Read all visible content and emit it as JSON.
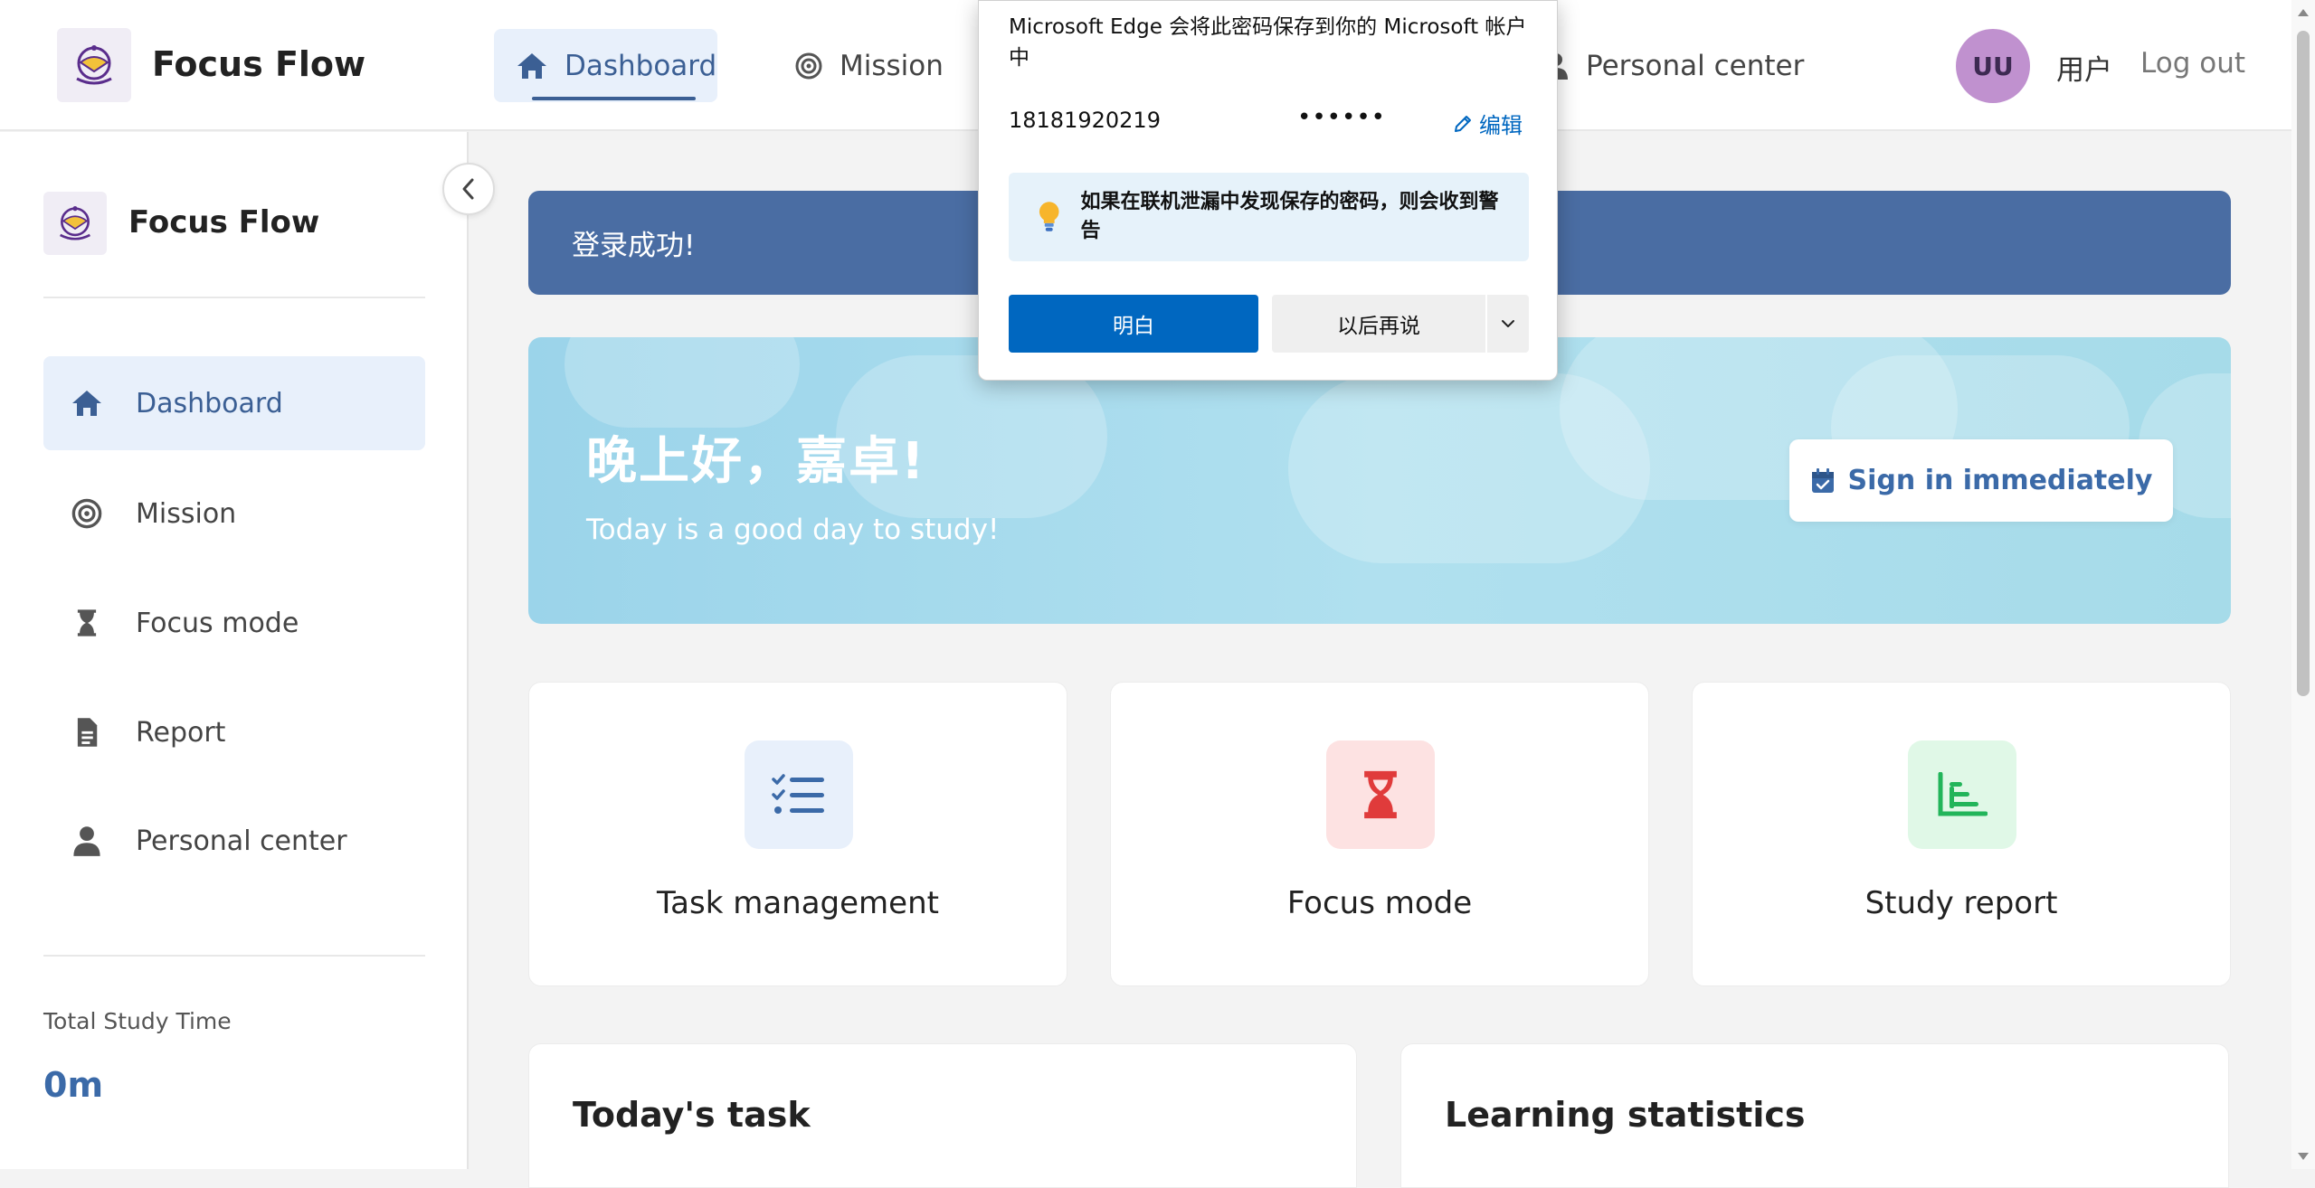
{
  "app": {
    "brand": "Focus Flow"
  },
  "topnav": {
    "items": [
      {
        "label": "Dashboard",
        "icon": "home-icon",
        "active": true
      },
      {
        "label": "Mission",
        "icon": "target-icon"
      },
      {
        "label": "Personal center",
        "icon": "user-icon"
      }
    ],
    "avatar_initials": "UU",
    "user_name": "用户",
    "logout": "Log out"
  },
  "sidebar": {
    "brand": "Focus Flow",
    "items": [
      {
        "label": "Dashboard",
        "icon": "home-icon",
        "active": true
      },
      {
        "label": "Mission",
        "icon": "target-icon"
      },
      {
        "label": "Focus mode",
        "icon": "hourglass-icon"
      },
      {
        "label": "Report",
        "icon": "document-icon"
      },
      {
        "label": "Personal center",
        "icon": "user-icon"
      }
    ],
    "total_label": "Total Study Time",
    "total_value": "0m"
  },
  "toast": {
    "message": "登录成功!"
  },
  "hero": {
    "greeting": "晚上好，嘉卓!",
    "subtitle": "Today is a good day to study!",
    "signin_label": "Sign in immediately"
  },
  "cards": [
    {
      "label": "Task management",
      "icon": "checklist-icon",
      "color": "#3b6aa8",
      "bg": "#e8f0fb"
    },
    {
      "label": "Focus mode",
      "icon": "hourglass-icon",
      "color": "#e03b3b",
      "bg": "#fde2e2"
    },
    {
      "label": "Study report",
      "icon": "chart-icon",
      "color": "#22b55a",
      "bg": "#e0f8e7"
    }
  ],
  "panels": [
    {
      "title": "Today's task"
    },
    {
      "title": "Learning statistics"
    }
  ],
  "password_popup": {
    "title": "Microsoft Edge 会将此密码保存到你的 Microsoft 帐户中",
    "username": "18181920219",
    "password_mask": "••••••",
    "edit_label": "编辑",
    "info": "如果在联机泄漏中发现保存的密码，则会收到警告",
    "ok_label": "明白",
    "later_label": "以后再说"
  },
  "colors": {
    "accent": "#3b5f94",
    "toast_bg": "#4a6da3",
    "edge_blue": "#0067c0",
    "avatar_bg": "#c091cf"
  }
}
